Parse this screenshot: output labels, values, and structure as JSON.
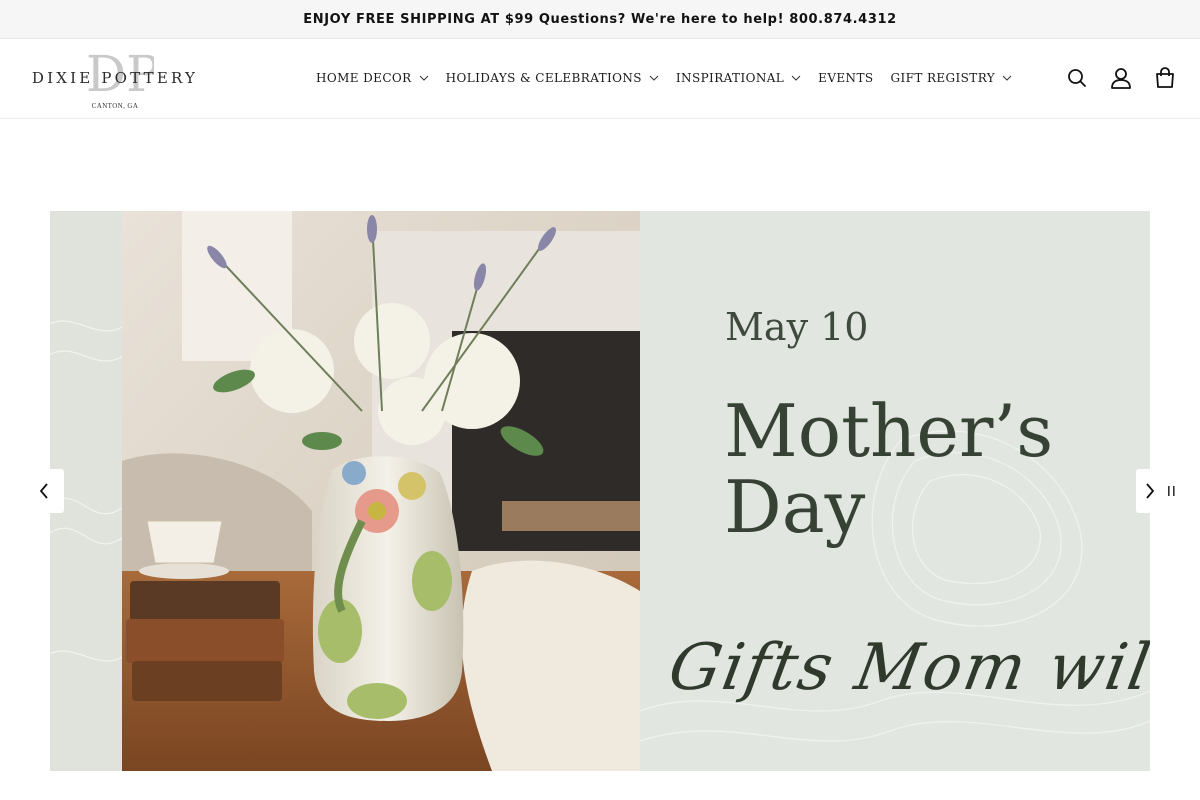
{
  "announcement": {
    "text": "ENJOY FREE SHIPPING AT $99 Questions? We're here to help! 800.874.4312"
  },
  "logo": {
    "monogram": "DP",
    "name": "DIXIE POTTERY",
    "location": "CANTON, GA"
  },
  "nav": {
    "items": [
      {
        "label": "HOME DECOR",
        "has_dropdown": true
      },
      {
        "label": "HOLIDAYS & CELEBRATIONS",
        "has_dropdown": true
      },
      {
        "label": "INSPIRATIONAL",
        "has_dropdown": true
      },
      {
        "label": "EVENTS",
        "has_dropdown": false
      },
      {
        "label": "GIFT REGISTRY",
        "has_dropdown": true
      }
    ]
  },
  "header_icons": [
    "search-icon",
    "account-icon",
    "cart-icon"
  ],
  "hero": {
    "date": "May 10",
    "title_line1": "Mother’s",
    "title_line2": "Day",
    "script": "Gifts Mom will l"
  },
  "colors": {
    "announcement_bg": "#f6f6f6",
    "hero_panel_bg": "#e2e6e0",
    "hero_text": "#364234"
  }
}
